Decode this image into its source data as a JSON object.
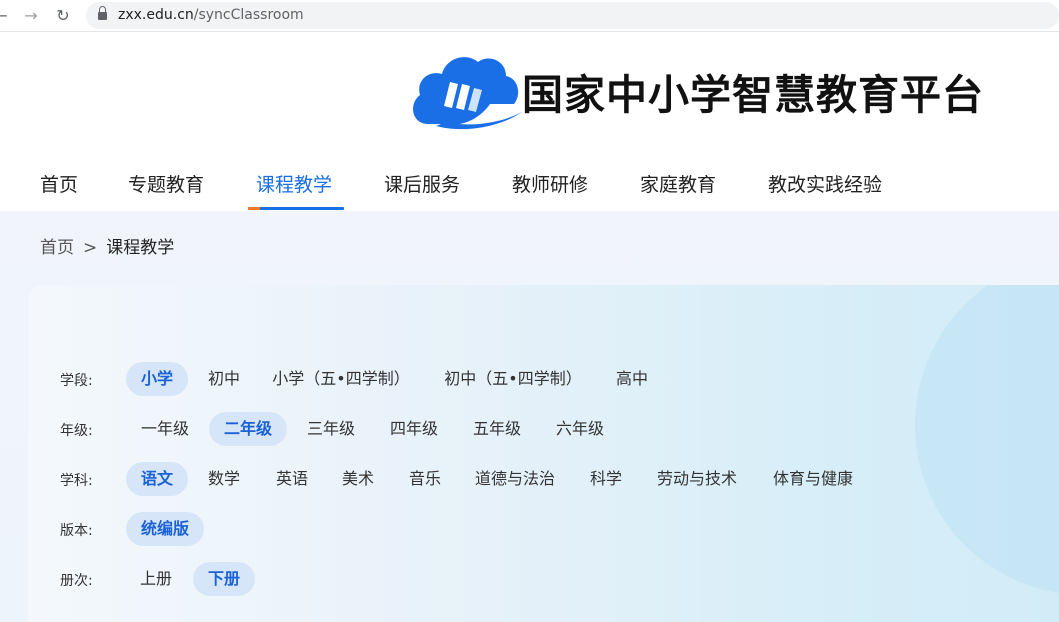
{
  "browser": {
    "url_host": "zxx.edu.cn",
    "url_path": "/syncClassroom"
  },
  "brand": {
    "title": "国家中小学智慧教育平台",
    "logo_color": "#1a6fe6"
  },
  "mainnav": {
    "items": [
      {
        "label": "首页"
      },
      {
        "label": "专题教育"
      },
      {
        "label": "课程教学",
        "active": true
      },
      {
        "label": "课后服务"
      },
      {
        "label": "教师研修"
      },
      {
        "label": "家庭教育"
      },
      {
        "label": "教改实践经验"
      }
    ]
  },
  "breadcrumb": {
    "home": "首页",
    "separator": ">",
    "current": "课程教学"
  },
  "filters": {
    "stage": {
      "label": "学段:",
      "options": [
        "小学",
        "初中",
        "小学（五•四学制）",
        "初中（五•四学制）",
        "高中"
      ],
      "selected": "小学"
    },
    "grade": {
      "label": "年级:",
      "options": [
        "一年级",
        "二年级",
        "三年级",
        "四年级",
        "五年级",
        "六年级"
      ],
      "selected": "二年级"
    },
    "subject": {
      "label": "学科:",
      "options": [
        "语文",
        "数学",
        "英语",
        "美术",
        "音乐",
        "道德与法治",
        "科学",
        "劳动与技术",
        "体育与健康"
      ],
      "selected": "语文"
    },
    "edition": {
      "label": "版本:",
      "options": [
        "统编版"
      ],
      "selected": "统编版"
    },
    "volume": {
      "label": "册次:",
      "options": [
        "上册",
        "下册"
      ],
      "selected": "下册"
    }
  },
  "colors": {
    "accent": "#1a6fe6",
    "selected_bg": "#d6e6f8",
    "selected_text": "#1a62d6",
    "nav_underline_tip": "#f07a2b"
  }
}
